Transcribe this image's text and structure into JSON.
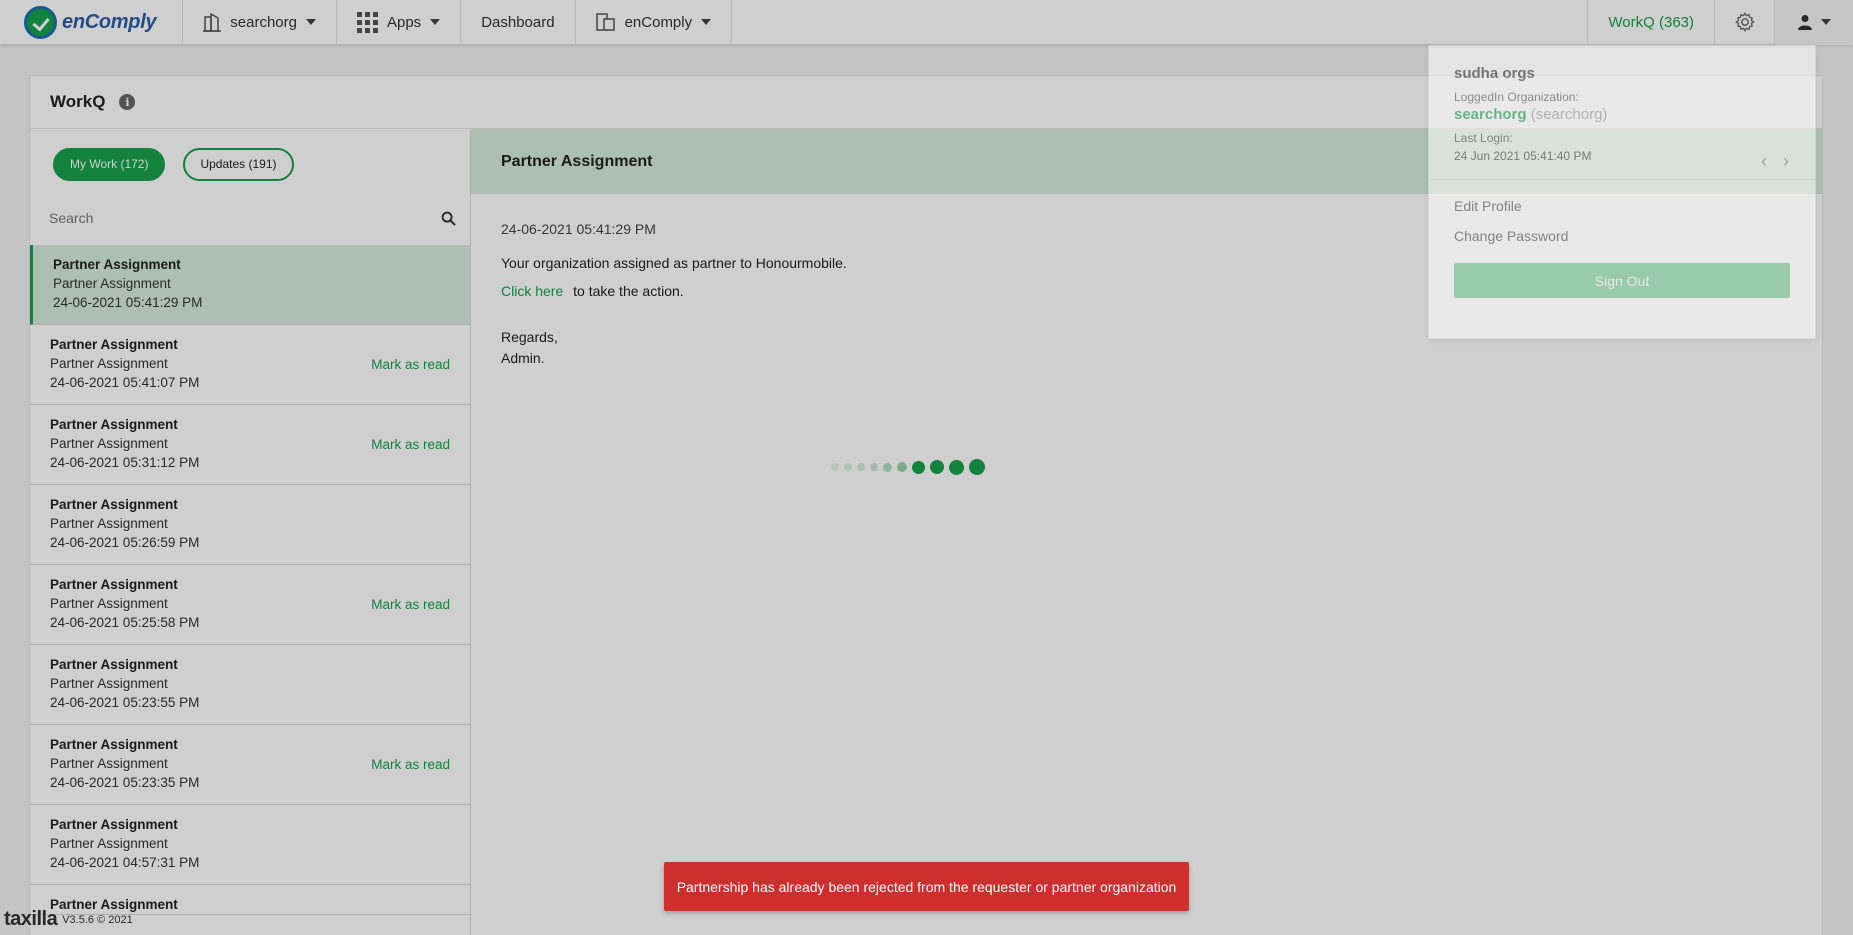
{
  "nav": {
    "brand": "enComply",
    "org": "searchorg",
    "apps": "Apps",
    "dashboard": "Dashboard",
    "module": "enComply",
    "workq": "WorkQ (363)"
  },
  "page": {
    "title": "WorkQ"
  },
  "pills": {
    "my_work": "My Work (172)",
    "updates": "Updates (191)"
  },
  "search": {
    "placeholder": "Search"
  },
  "list": [
    {
      "title": "Partner Assignment",
      "sub": "Partner Assignment",
      "date": "24-06-2021 05:41:29 PM",
      "mark": ""
    },
    {
      "title": "Partner Assignment",
      "sub": "Partner Assignment",
      "date": "24-06-2021 05:41:07 PM",
      "mark": "Mark as read"
    },
    {
      "title": "Partner Assignment",
      "sub": "Partner Assignment",
      "date": "24-06-2021 05:31:12 PM",
      "mark": "Mark as read"
    },
    {
      "title": "Partner Assignment",
      "sub": "Partner Assignment",
      "date": "24-06-2021 05:26:59 PM",
      "mark": ""
    },
    {
      "title": "Partner Assignment",
      "sub": "Partner Assignment",
      "date": "24-06-2021 05:25:58 PM",
      "mark": "Mark as read"
    },
    {
      "title": "Partner Assignment",
      "sub": "Partner Assignment",
      "date": "24-06-2021 05:23:55 PM",
      "mark": ""
    },
    {
      "title": "Partner Assignment",
      "sub": "Partner Assignment",
      "date": "24-06-2021 05:23:35 PM",
      "mark": "Mark as read"
    },
    {
      "title": "Partner Assignment",
      "sub": "Partner Assignment",
      "date": "24-06-2021 04:57:31 PM",
      "mark": ""
    },
    {
      "title": "Partner Assignment",
      "sub": "",
      "date": "",
      "mark": ""
    }
  ],
  "detail": {
    "title": "Partner Assignment",
    "date": "24-06-2021 05:41:29 PM",
    "message": "Your organization assigned as partner to Honourmobile.",
    "link": "Click here",
    "action_text": "to take the action.",
    "regards": "Regards,",
    "signature": "Admin."
  },
  "profile": {
    "name": "sudha orgs",
    "org_label": "LoggedIn Organization:",
    "org": "searchorg",
    "org_code": "(searchorg)",
    "last_login_label": "Last Login:",
    "last_login": "24 Jun 2021 05:41:40 PM",
    "edit_profile": "Edit Profile",
    "change_password": "Change Password",
    "sign_out": "Sign Out"
  },
  "toast": "Partnership has already been rejected from the requester or partner organization",
  "footer": {
    "logo": "taxilla",
    "version": "V3.5.6 © 2021"
  },
  "colors": {
    "accent": "#18a04a",
    "error": "#cf2e2e"
  }
}
